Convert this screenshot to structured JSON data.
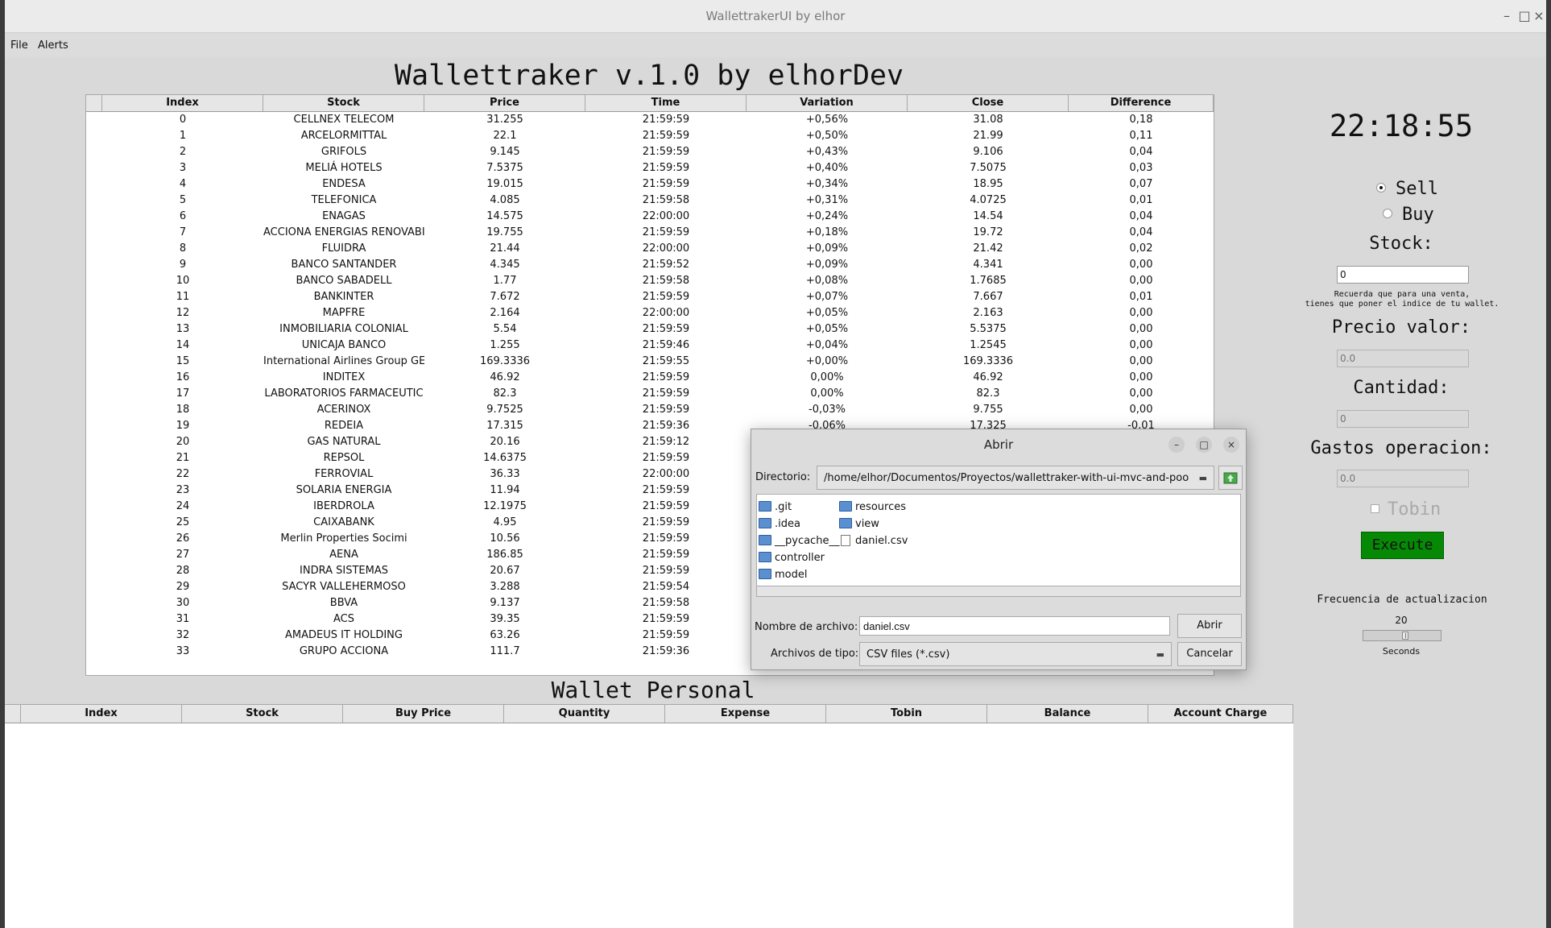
{
  "window": {
    "title": "WallettrakerUI by elhor",
    "minimize": "–",
    "maximize": "□",
    "close": "×"
  },
  "menu": [
    "File",
    "Alerts"
  ],
  "app_title": "Wallettraker v.1.0 by elhorDev",
  "stock_table": {
    "columns": [
      "Index",
      "Stock",
      "Price",
      "Time",
      "Variation",
      "Close",
      "Difference"
    ],
    "rows": [
      [
        "0",
        "CELLNEX TELECOM",
        "31.255",
        "21:59:59",
        "+0,56%",
        "31.08",
        "0,18"
      ],
      [
        "1",
        "ARCELORMITTAL",
        "22.1",
        "21:59:59",
        "+0,50%",
        "21.99",
        "0,11"
      ],
      [
        "2",
        "GRIFOLS",
        "9.145",
        "21:59:59",
        "+0,43%",
        "9.106",
        "0,04"
      ],
      [
        "3",
        "MELIÁ HOTELS",
        "7.5375",
        "21:59:59",
        "+0,40%",
        "7.5075",
        "0,03"
      ],
      [
        "4",
        "ENDESA",
        "19.015",
        "21:59:59",
        "+0,34%",
        "18.95",
        "0,07"
      ],
      [
        "5",
        "TELEFONICA",
        "4.085",
        "21:59:58",
        "+0,31%",
        "4.0725",
        "0,01"
      ],
      [
        "6",
        "ENAGAS",
        "14.575",
        "22:00:00",
        "+0,24%",
        "14.54",
        "0,04"
      ],
      [
        "7",
        "ACCIONA ENERGIAS RENOVABI",
        "19.755",
        "21:59:59",
        "+0,18%",
        "19.72",
        "0,04"
      ],
      [
        "8",
        "FLUIDRA",
        "21.44",
        "22:00:00",
        "+0,09%",
        "21.42",
        "0,02"
      ],
      [
        "9",
        "BANCO SANTANDER",
        "4.345",
        "21:59:52",
        "+0,09%",
        "4.341",
        "0,00"
      ],
      [
        "10",
        "BANCO SABADELL",
        "1.77",
        "21:59:58",
        "+0,08%",
        "1.7685",
        "0,00"
      ],
      [
        "11",
        "BANKINTER",
        "7.672",
        "21:59:59",
        "+0,07%",
        "7.667",
        "0,01"
      ],
      [
        "12",
        "MAPFRE",
        "2.164",
        "22:00:00",
        "+0,05%",
        "2.163",
        "0,00"
      ],
      [
        "13",
        "INMOBILIARIA COLONIAL",
        "5.54",
        "21:59:59",
        "+0,05%",
        "5.5375",
        "0,00"
      ],
      [
        "14",
        "UNICAJA BANCO",
        "1.255",
        "21:59:46",
        "+0,04%",
        "1.2545",
        "0,00"
      ],
      [
        "15",
        "International Airlines Group GE",
        "169.3336",
        "21:59:55",
        "+0,00%",
        "169.3336",
        "0,00"
      ],
      [
        "16",
        "INDITEX",
        "46.92",
        "21:59:59",
        "0,00%",
        "46.92",
        "0,00"
      ],
      [
        "17",
        "LABORATORIOS FARMACEUTIC",
        "82.3",
        "21:59:59",
        "0,00%",
        "82.3",
        "0,00"
      ],
      [
        "18",
        "ACERINOX",
        "9.7525",
        "21:59:59",
        "-0,03%",
        "9.755",
        "0,00"
      ],
      [
        "19",
        "REDEIA",
        "17.315",
        "21:59:36",
        "-0,06%",
        "17.325",
        "-0,01"
      ],
      [
        "20",
        "GAS NATURAL",
        "20.16",
        "21:59:12",
        "",
        "",
        ""
      ],
      [
        "21",
        "REPSOL",
        "14.6375",
        "21:59:59",
        "",
        "",
        ""
      ],
      [
        "22",
        "FERROVIAL",
        "36.33",
        "22:00:00",
        "",
        "",
        ""
      ],
      [
        "23",
        "SOLARIA ENERGIA",
        "11.94",
        "21:59:59",
        "",
        "",
        ""
      ],
      [
        "24",
        "IBERDROLA",
        "12.1975",
        "21:59:59",
        "",
        "",
        ""
      ],
      [
        "25",
        "CAIXABANK",
        "4.95",
        "21:59:59",
        "",
        "",
        ""
      ],
      [
        "26",
        "Merlin Properties Socimi",
        "10.56",
        "21:59:59",
        "",
        "",
        ""
      ],
      [
        "27",
        "AENA",
        "186.85",
        "21:59:59",
        "",
        "",
        ""
      ],
      [
        "28",
        "INDRA SISTEMAS",
        "20.67",
        "21:59:59",
        "",
        "",
        ""
      ],
      [
        "29",
        "SACYR VALLEHERMOSO",
        "3.288",
        "21:59:54",
        "",
        "",
        ""
      ],
      [
        "30",
        "BBVA",
        "9.137",
        "21:59:58",
        "",
        "",
        ""
      ],
      [
        "31",
        "ACS",
        "39.35",
        "21:59:59",
        "",
        "",
        ""
      ],
      [
        "32",
        "AMADEUS IT HOLDING",
        "63.26",
        "21:59:59",
        "",
        "",
        ""
      ],
      [
        "33",
        "GRUPO ACCIONA",
        "111.7",
        "21:59:36",
        "",
        "",
        ""
      ]
    ]
  },
  "wallet": {
    "title": "Wallet Personal",
    "columns": [
      "Index",
      "Stock",
      "Buy Price",
      "Quantity",
      "Expense",
      "Tobin",
      "Balance",
      "Account Charge"
    ]
  },
  "side": {
    "clock": "22:18:55",
    "sell_label": "Sell",
    "buy_label": "Buy",
    "stock_label": "Stock:",
    "stock_value": "0",
    "hint_line1": "Recuerda que para una venta,",
    "hint_line2": "tienes que poner el indice de tu wallet.",
    "price_label": "Precio valor:",
    "price_placeholder": "0.0",
    "quantity_label": "Cantidad:",
    "quantity_placeholder": "0",
    "fees_label": "Gastos operacion:",
    "fees_placeholder": "0.0",
    "tobin_label": "Tobin",
    "execute_label": "Execute",
    "freq_label": "Frecuencia de actualizacion",
    "freq_value": "20",
    "freq_level_fraction": 0.55,
    "seconds_label": "Seconds",
    "execute_color": "#068a06"
  },
  "dialog": {
    "title": "Abrir",
    "dir_label": "Directorio:",
    "dir_value": "/home/elhor/Documentos/Proyectos/wallettraker-with-ui-mvc-and-poo",
    "folders_col1": [
      ".git",
      ".idea",
      "__pycache__",
      "controller",
      "model"
    ],
    "folders_col2": [
      "resources",
      "view"
    ],
    "file": "daniel.csv",
    "filename_label": "Nombre de archivo:",
    "filename_value": "daniel.csv",
    "open_button": "Abrir",
    "filetype_label": "Archivos de tipo:",
    "filetype_value": "CSV files (*.csv)",
    "cancel_button": "Cancelar"
  }
}
